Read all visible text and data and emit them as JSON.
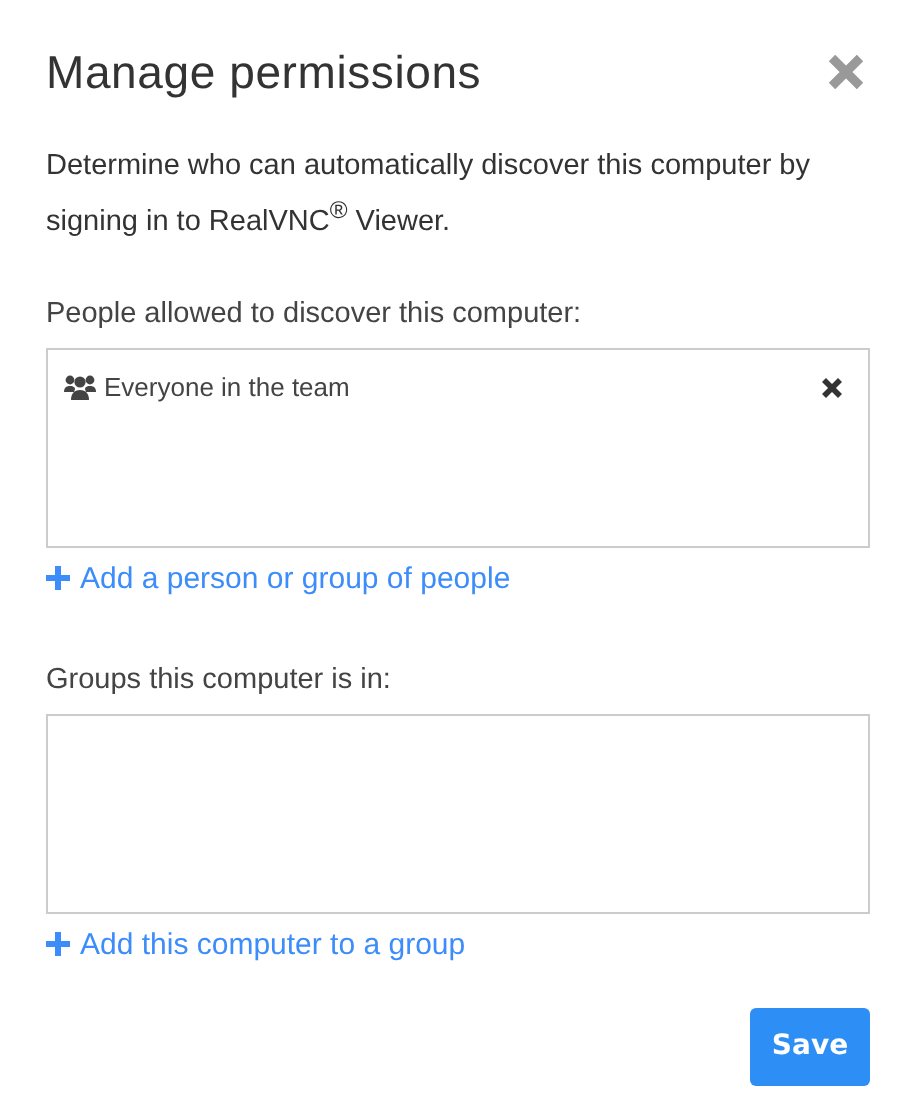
{
  "dialog": {
    "title": "Manage permissions",
    "description": "Determine who can automatically discover this computer by signing in to RealVNC$^{®}$ Viewer."
  },
  "sections": [
    {
      "label": "People allowed to discover this computer:",
      "entries": [
        {
          "name": "Everyone in the team",
          "kind": "group"
        }
      ],
      "add_link": "Add a person or group of people"
    },
    {
      "label": "Groups this computer is in:",
      "add_link": "Add this computer to a group"
    }
  ],
  "buttons": [
    "Save"
  ]
}
